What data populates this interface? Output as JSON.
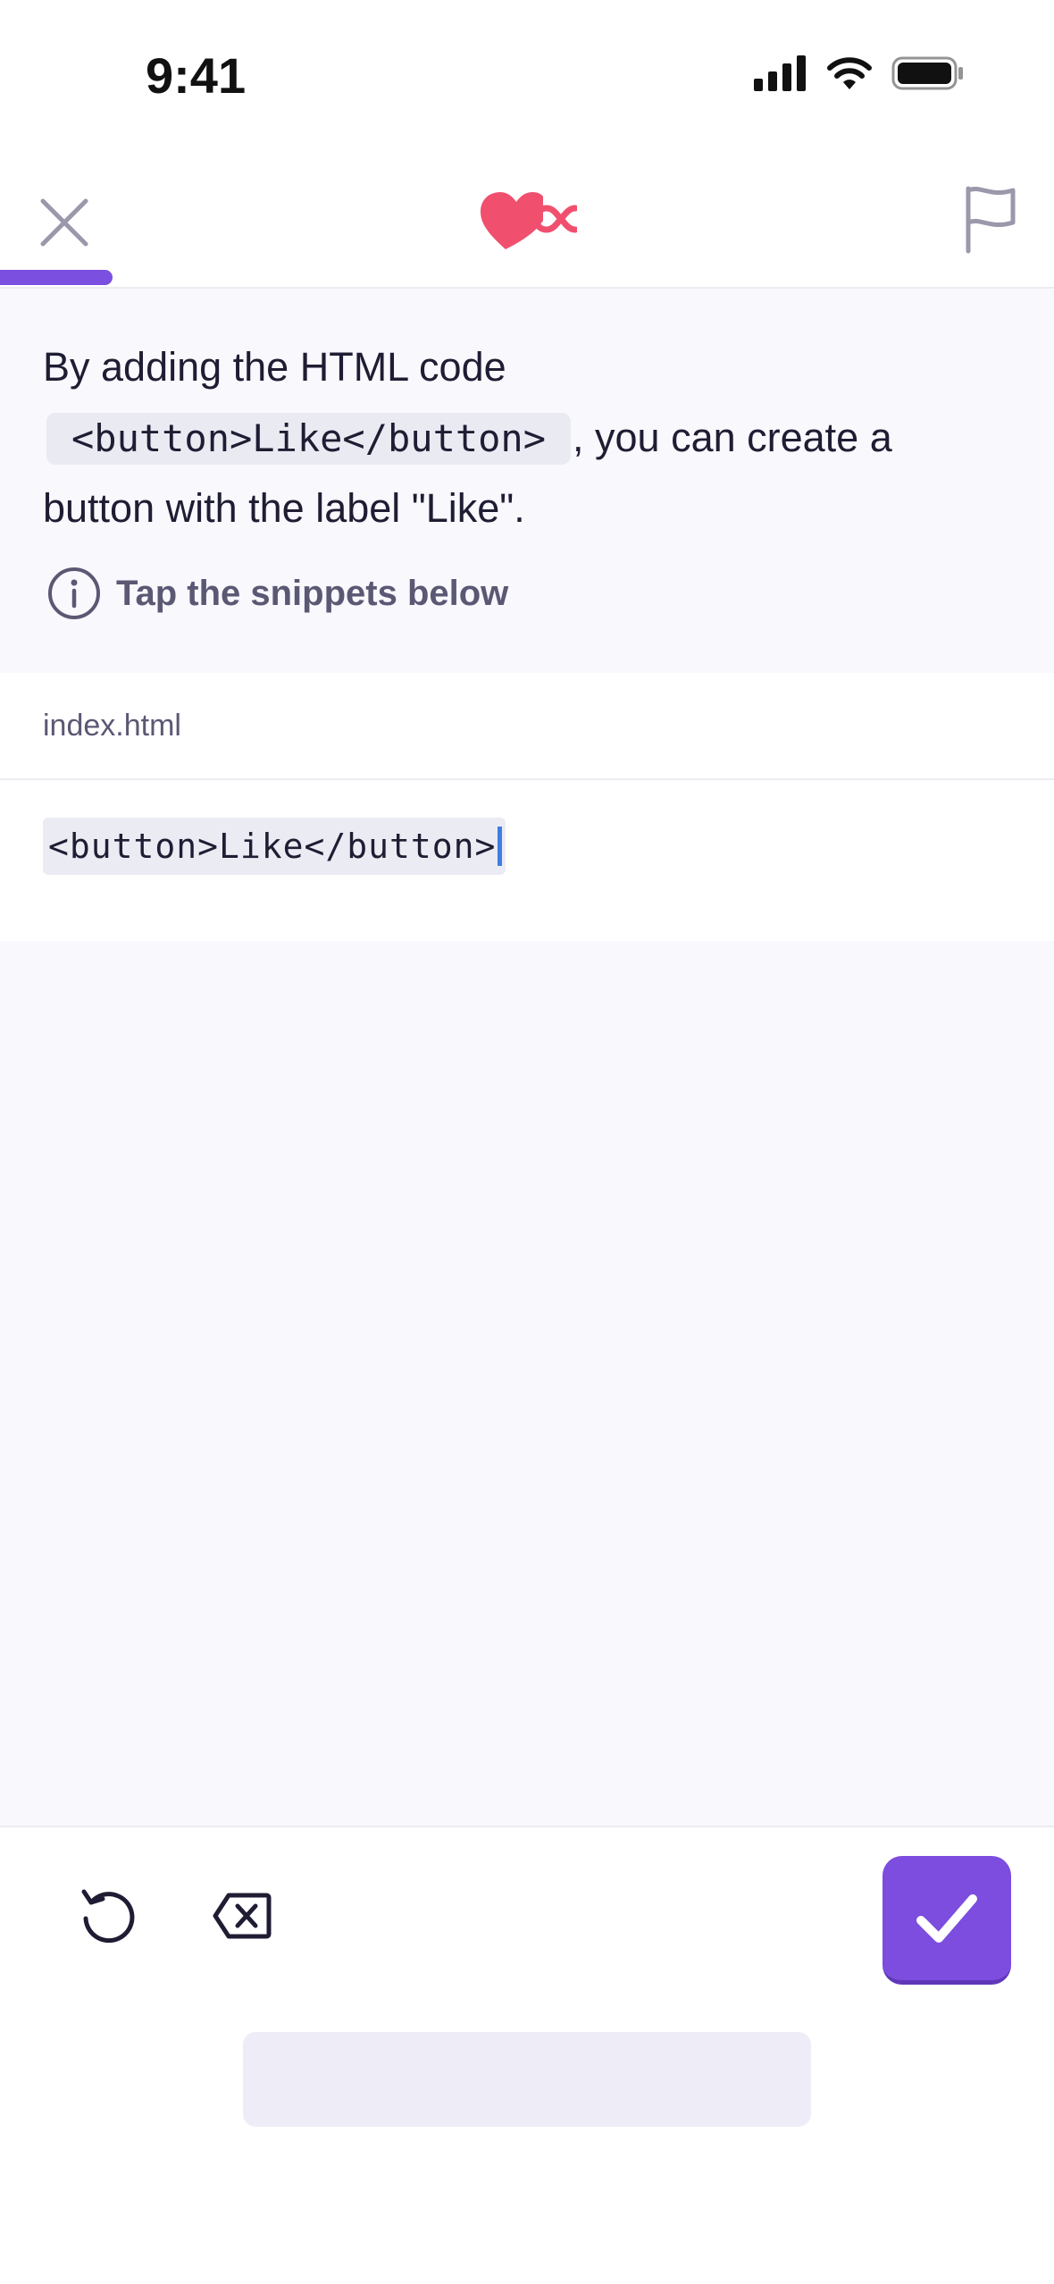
{
  "status_bar": {
    "time": "9:41"
  },
  "nav": {
    "close_icon": "close-icon",
    "logo_icon": "heart-infinity-icon",
    "flag_icon": "flag-icon",
    "progress": 0.107,
    "accent": "#7b4fe0"
  },
  "instructions": {
    "text_before": "By adding the HTML code",
    "code": "<button>Like</button>",
    "text_after": ", you can create a button with the label \"Like\".",
    "hint": "Tap the snippets below"
  },
  "editor": {
    "file_name": "index.html",
    "code_line": "<button>Like</button>"
  },
  "toolbar": {
    "undo_icon": "undo-icon",
    "delete_icon": "backspace-icon",
    "check_icon": "check-icon",
    "check_color": "#7c4ddf"
  },
  "colors": {
    "heart": "#f0506e",
    "panel_bg": "#f8f8fd",
    "muted_text": "#5b5874"
  }
}
